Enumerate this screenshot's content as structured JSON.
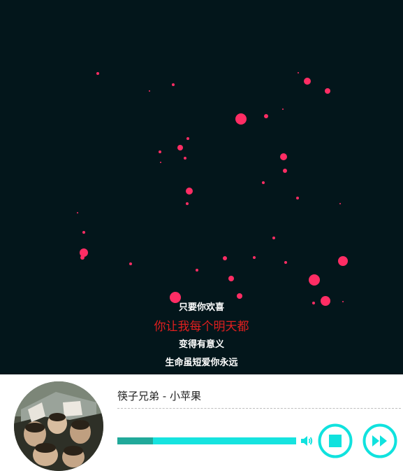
{
  "song": {
    "title": "筷子兄弟 - 小苹果"
  },
  "lyrics": {
    "lines": [
      "只要你欢喜",
      "你让我每个明天都",
      "变得有意义",
      "生命虽短爱你永远"
    ],
    "current_index": 1
  },
  "playback": {
    "progress": 0.2
  },
  "icons": {
    "volume": "speaker-icon",
    "stop": "stop-icon",
    "next": "fast-forward-icon"
  },
  "colors": {
    "visualizer_bg": "#03161b",
    "particle": "#ff2d64",
    "accent": "#10e2de",
    "progress_played": "#21a99a",
    "lyric_current": "#e21f1f"
  }
}
